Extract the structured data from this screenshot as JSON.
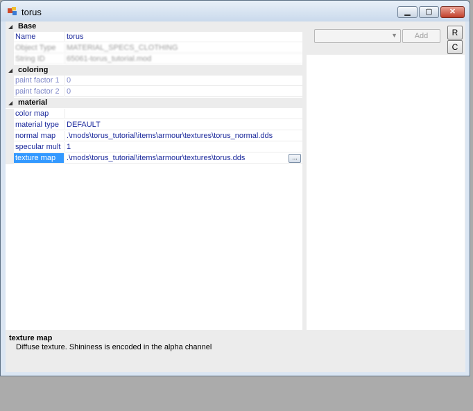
{
  "window": {
    "title": "torus"
  },
  "grid": {
    "categories": [
      {
        "label": "Base",
        "rows": [
          {
            "name": "Name",
            "value": "torus"
          },
          {
            "name": "Object Type",
            "value": "MATERIAL_SPECS_CLOTHING"
          },
          {
            "name": "String ID",
            "value": "65061-torus_tutorial.mod"
          }
        ]
      },
      {
        "label": "coloring",
        "rows": [
          {
            "name": "paint factor 1",
            "value": "0"
          },
          {
            "name": "paint factor 2",
            "value": "0"
          }
        ]
      },
      {
        "label": "material",
        "rows": [
          {
            "name": "color map",
            "value": ""
          },
          {
            "name": "material type",
            "value": "DEFAULT"
          },
          {
            "name": "normal map",
            "value": ".\\mods\\torus_tutorial\\items\\armour\\textures\\torus_normal.dds"
          },
          {
            "name": "specular mult",
            "value": "1"
          },
          {
            "name": "texture map",
            "value": ".\\mods\\torus_tutorial\\items\\armour\\textures\\torus.dds",
            "ellipsis": "..."
          }
        ]
      }
    ]
  },
  "help": {
    "title": "texture map",
    "description": "Diffuse texture. Shininess is encoded in the alpha channel"
  },
  "right_panel": {
    "combo_value": "",
    "add_label": "Add",
    "r_label": "R",
    "c_label": "C"
  },
  "colors": {
    "selection": "#3399ff",
    "property_text": "#1c2a9c"
  },
  "icons": {
    "collapse": "collapse-triangle-icon",
    "app": "app-icon"
  }
}
